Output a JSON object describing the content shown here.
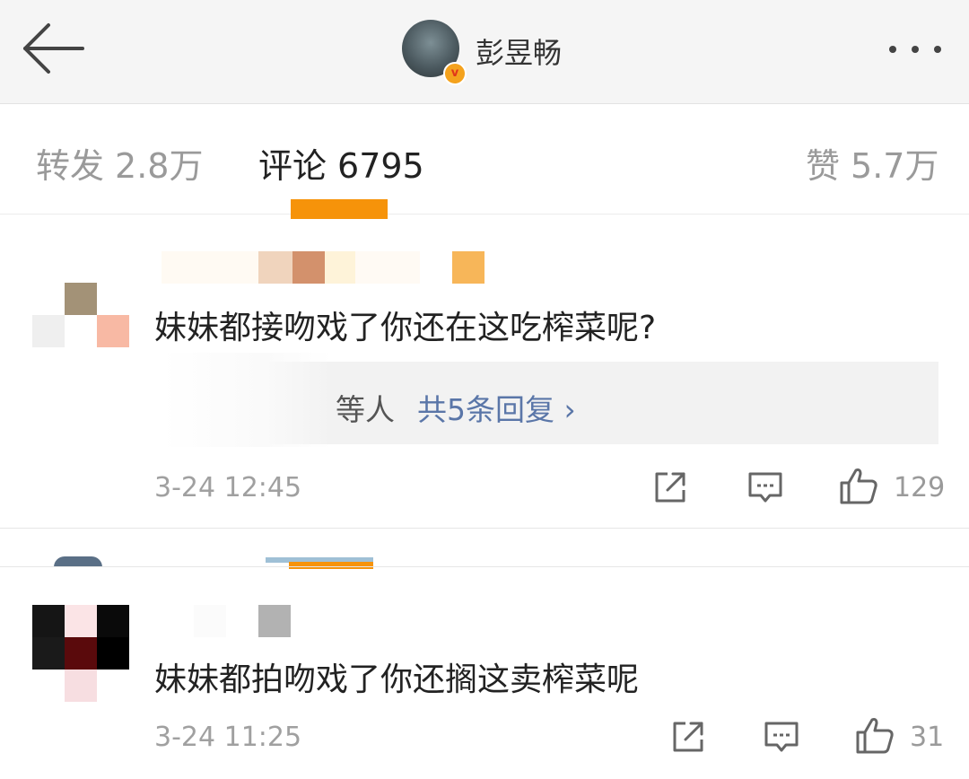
{
  "header": {
    "username": "彭昱畅",
    "badge": "v"
  },
  "tabs": [
    {
      "label": "转发",
      "count": "2.8万"
    },
    {
      "label": "评论",
      "count": "6795"
    },
    {
      "label": "赞",
      "count": "5.7万"
    }
  ],
  "comments": [
    {
      "text": "妹妹都接吻戏了你还在这吃榨菜呢?",
      "reply_people": "等人",
      "reply_link": "共5条回复 ›",
      "time": "3-24 12:45",
      "likes": "129"
    },
    {
      "text": "妹妹都拍吻戏了你还搁这卖榨菜呢",
      "time": "3-24 11:25",
      "likes": "31"
    }
  ],
  "colors": {
    "accent": "#f6930a",
    "link": "#5a76a8",
    "header_bg": "#f5f5f5"
  },
  "icons": [
    "back-arrow-icon",
    "more-dots-icon",
    "share-icon",
    "comment-icon",
    "thumbs-up-icon"
  ]
}
